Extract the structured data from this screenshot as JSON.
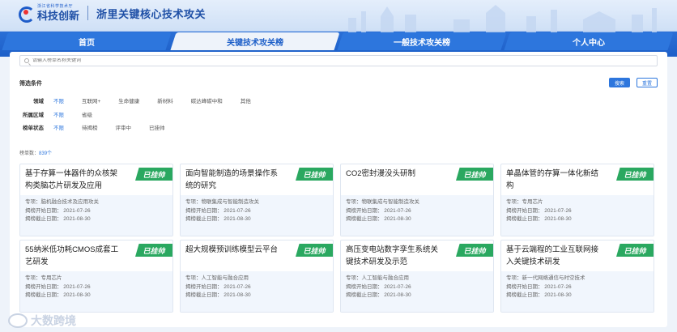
{
  "header": {
    "logo_small": "浙江省科学技术厅",
    "logo_big": "科技创新",
    "site_title": "浙里关键核心技术攻关"
  },
  "tabs": [
    {
      "label": "首页"
    },
    {
      "label": "关键技术攻关榜",
      "active": true
    },
    {
      "label": "一般技术攻关榜"
    },
    {
      "label": "个人中心"
    }
  ],
  "search": {
    "placeholder": "请输入榜单名称关键词"
  },
  "filters": {
    "title": "筛选条件",
    "search_btn": "搜索",
    "reset_btn": "重置",
    "rows": [
      {
        "label": "领域",
        "options": [
          "不限",
          "互联网+",
          "生命健康",
          "新材料",
          "碳达峰碳中和",
          "其他"
        ]
      },
      {
        "label": "所属区域",
        "options": [
          "不限",
          "省级"
        ]
      },
      {
        "label": "榜单状态",
        "options": [
          "不限",
          "待揭榜",
          "评审中",
          "已挂帅"
        ]
      }
    ]
  },
  "count": {
    "label": "榜单数：",
    "value": "839个"
  },
  "cards": [
    {
      "title": "基于存算一体器件的众核架构类脑芯片研发及应用",
      "badge": "已挂帅",
      "field": "专项：脑机融合技术及应用攻关",
      "start": "揭榜开始日期：  2021-07-26",
      "end": "揭榜截止日期：  2021-08-30"
    },
    {
      "title": "面向智能制造的场景操作系统的研究",
      "badge": "已挂帅",
      "field": "专项：物联集成与智能制造攻关",
      "start": "揭榜开始日期：  2021-07-26",
      "end": "揭榜截止日期：  2021-08-30"
    },
    {
      "title": "CO2密封漫没头研制",
      "badge": "已挂帅",
      "field": "专项：物联集成与智能制造攻关",
      "start": "揭榜开始日期：  2021-07-26",
      "end": "揭榜截止日期：  2021-08-30"
    },
    {
      "title": "单晶体管的存算一体化新结构",
      "badge": "已挂帅",
      "field": "专项：专用芯片",
      "start": "揭榜开始日期：  2021-07-26",
      "end": "揭榜截止日期：  2021-08-30"
    },
    {
      "title": "55纳米低功耗CMOS成套工艺研发",
      "badge": "已挂帅",
      "field": "专项：专用芯片",
      "start": "揭榜开始日期：  2021-07-26",
      "end": "揭榜截止日期：  2021-08-30"
    },
    {
      "title": "超大规模预训练模型云平台",
      "badge": "已挂帅",
      "field": "专项：人工智能与融合应用",
      "start": "揭榜开始日期：  2021-07-26",
      "end": "揭榜截止日期：  2021-08-30"
    },
    {
      "title": "高压变电站数字孪生系统关键技术研发及示范",
      "badge": "已挂帅",
      "field": "专项：人工智能与融合应用",
      "start": "揭榜开始日期：  2021-07-26",
      "end": "揭榜截止日期：  2021-08-30"
    },
    {
      "title": "基于云端程的工业互联网接入关键技术研发",
      "badge": "已挂帅",
      "field": "专项：新一代网络通信与时空技术",
      "start": "揭榜开始日期：  2021-07-26",
      "end": "揭榜截止日期：  2021-08-30"
    }
  ],
  "watermark": "大数跨境"
}
